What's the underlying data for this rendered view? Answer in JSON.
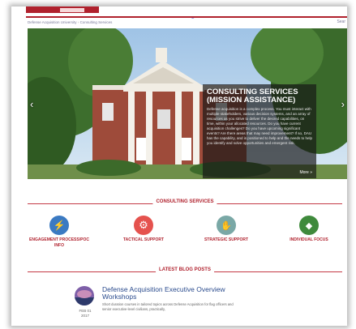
{
  "header": {
    "corner_mark": "y",
    "breadcrumb": [
      "Defense Acquisition University",
      "Consulting Services"
    ],
    "breadcrumb_sep": "›",
    "search_label": "Sear"
  },
  "hero": {
    "prev_icon": "chevron-left-icon",
    "next_icon": "chevron-right-icon",
    "prev_glyph": "‹",
    "next_glyph": "›",
    "caption_title": "CONSULTING SERVICES (MISSION ASSISTANCE)",
    "caption_body": "Defense acquisition is a complex process. You must interact with multiple stakeholders, various decision systems, and an array of resources as you strive to deliver the desired capabilities, on time, within your allocated resources. Do you have current acquisition challenges? Do you have upcoming significant events? Are there areas that may need improvement? If so, DAU has the capability, and is positioned to help and the needs to help you identify and solve opportunities and emergent risk.",
    "caption_more": "More »"
  },
  "services": {
    "heading": "CONSULTING SERVICES",
    "items": [
      {
        "label": "ENGAGEMENT PROCESS/POC INFO",
        "color": "#3b7ac2",
        "icon": "lightning-icon",
        "glyph": "⚡"
      },
      {
        "label": "TACTICAL SUPPORT",
        "color": "#e5524e",
        "icon": "gears-icon",
        "glyph": "⚙"
      },
      {
        "label": "STRATEGIC SUPPORT",
        "color": "#7aa8a6",
        "icon": "handshake-icon",
        "glyph": "✋"
      },
      {
        "label": "INDIVIDUAL FOCUS",
        "color": "#3f8a3c",
        "icon": "tag-icon",
        "glyph": "◆"
      }
    ]
  },
  "blog": {
    "heading": "LATEST BLOG POSTS",
    "post": {
      "title": "Defense Acquisition Executive Overview Workshops",
      "date_month_day": "FEB 01",
      "date_year": "2017",
      "excerpt": "Short duration courses in tailored topics across Defense Acquisition for flag officers and senior executive-level civilians, practically,"
    }
  },
  "colors": {
    "brand_red": "#b0212d",
    "link_blue": "#2a4b8d"
  }
}
